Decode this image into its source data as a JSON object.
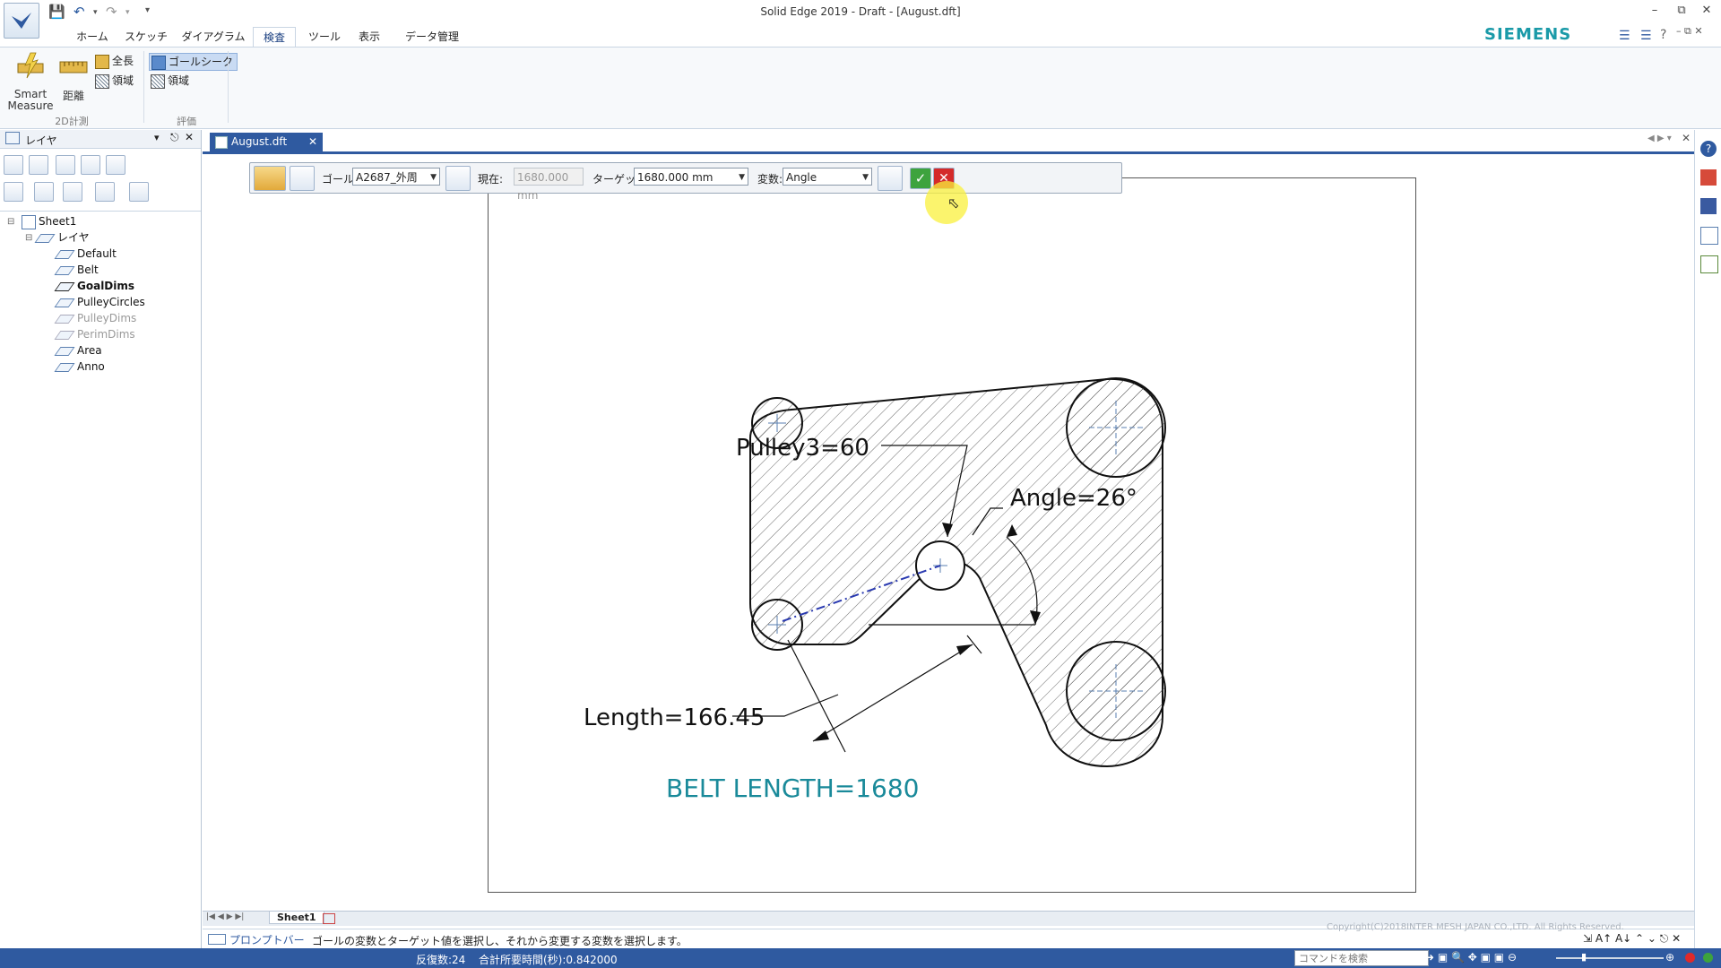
{
  "window": {
    "title": "Solid Edge 2019 - Draft - [August.dft]",
    "brand": "SIEMENS"
  },
  "ribbon": {
    "tabs": [
      "ホーム",
      "スケッチ",
      "ダイアグラム",
      "検査",
      "ツール",
      "表示",
      "データ管理"
    ],
    "active_tab": "検査",
    "smart_measure_line1": "Smart",
    "smart_measure_line2": "Measure",
    "distance": "距離",
    "total_length": "全長",
    "area1": "領域",
    "goal_seek": "ゴールシーク",
    "area2": "領域",
    "group_2d": "2D計測",
    "group_eval": "評価"
  },
  "left_pane": {
    "title": "レイヤ",
    "tree": {
      "sheet": "Sheet1",
      "folder": "レイヤ",
      "layers": [
        {
          "name": "Default",
          "state": "normal"
        },
        {
          "name": "Belt",
          "state": "normal"
        },
        {
          "name": "GoalDims",
          "state": "active"
        },
        {
          "name": "PulleyCircles",
          "state": "normal"
        },
        {
          "name": "PulleyDims",
          "state": "hidden"
        },
        {
          "name": "PerimDims",
          "state": "hidden"
        },
        {
          "name": "Area",
          "state": "normal"
        },
        {
          "name": "Anno",
          "state": "normal"
        }
      ]
    }
  },
  "document": {
    "tab_label": "August.dft",
    "sheet_tab": "Sheet1"
  },
  "command_bar": {
    "goal_label": "ゴール:",
    "goal_value": "A2687_外周",
    "current_label": "現在:",
    "current_value": "1680.000 mm",
    "target_label": "ターゲット:",
    "target_value": "1680.000 mm",
    "variable_label": "変数:",
    "variable_value": "Angle"
  },
  "drawing": {
    "pulley_label": "Pulley3=60",
    "angle_label": "Angle=26°",
    "length_label": "Length=166.45",
    "belt_length_label": "BELT LENGTH=1680"
  },
  "prompt_bar": {
    "label": "プロンプトバー",
    "message": "ゴールの変数とターゲット値を選択し、それから変更する変数を選択します。",
    "copyright": "Copyright(C)2018INTER MESH JAPAN CO.,LTD. All Rights Reserved."
  },
  "status_bar": {
    "iterations": "反復数:24",
    "total_time": "合計所要時間(秒):0.842000",
    "command_search_placeholder": "コマンドを検索"
  },
  "colors": {
    "accent": "#2f5aa0",
    "brand": "#1a9aa8",
    "annotation": "#1a8a9a"
  }
}
